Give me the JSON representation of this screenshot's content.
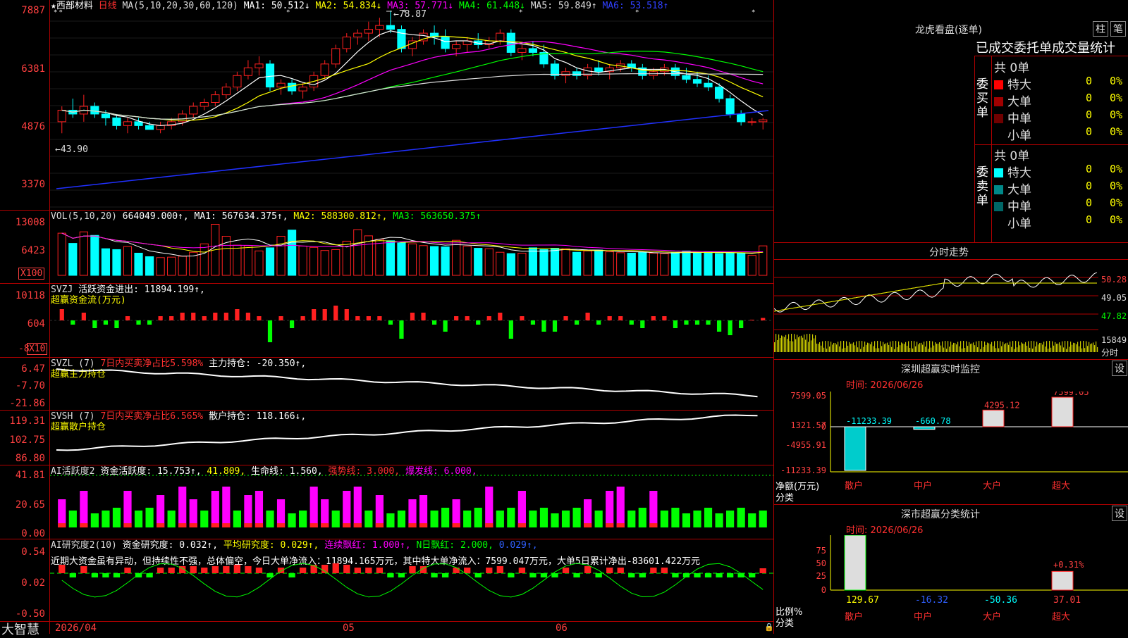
{
  "main_pane": {
    "stock_name": "西部材料",
    "period": "日线",
    "ma_label": "MA(5,10,20,30,60,120)",
    "ma_values": [
      {
        "label": "MA1: 50.512↓",
        "color": "#ffffff"
      },
      {
        "label": "MA2: 54.834↓",
        "color": "#ffff00"
      },
      {
        "label": "MA3: 57.771↓",
        "color": "#ff00ff"
      },
      {
        "label": "MA4: 61.448↓",
        "color": "#00ff00"
      },
      {
        "label": "MA5: 59.849↑",
        "color": "#dddddd"
      },
      {
        "label": "MA6: 53.518↑",
        "color": "#3040ff"
      }
    ],
    "y_ticks": [
      "7887",
      "6381",
      "4876",
      "3370"
    ],
    "high_label": "78.87",
    "low_label": "43.90"
  },
  "vol_pane": {
    "label": "VOL(5,10,20)",
    "value": "664049.000↑,",
    "ma1": "MA1: 567634.375↑,",
    "ma2": "MA2: 588300.812↑,",
    "ma3": "MA3: 563650.375↑",
    "y_ticks": [
      "13008",
      "6423"
    ],
    "unit": "X100"
  },
  "svzj_pane": {
    "label": "SVZJ",
    "title": "活跃资金进出: 11894.199↑,",
    "subtitle": "超赢资金流(万元)",
    "y_ticks": [
      "10118",
      "604",
      "-8"
    ],
    "unit": "X10"
  },
  "svzl_pane": {
    "label": "SVZL (7)",
    "ratio": "7日内买卖净占比5.598%",
    "hold": "主力持仓: -20.350↑,",
    "subtitle": "超赢主力持仓",
    "y_ticks": [
      "6.47",
      "-7.70",
      "-21.86"
    ]
  },
  "svsh_pane": {
    "label": "SVSH (7)",
    "ratio": "7日内买卖净占比6.565%",
    "hold": "散户持仓: 118.166↓,",
    "subtitle": "超赢散户持仓",
    "y_ticks": [
      "119.31",
      "102.75",
      "86.80"
    ]
  },
  "ai_active_pane": {
    "label": "AI活跃度2",
    "v1": "资金活跃度: 15.753↑,",
    "v2": "41.809,",
    "v3": "生命线: 1.560,",
    "v4": "强势线: 3.000,",
    "v5": "爆发线: 6.000,",
    "y_ticks": [
      "41.81",
      "20.65",
      "0.00"
    ]
  },
  "ai_research_pane": {
    "label": "AI研究度2(10)",
    "v1": "资金研究度: 0.032↑,",
    "v2": "平均研究度: 0.029↑,",
    "v3": "连续飘红: 1.000↑,",
    "v4": "N日飘红: 2.000,",
    "v5": "0.029↑,",
    "comment": "近期大资金虽有异动，但持续性不强，总体偏空，今日大单净流入：11894.165万元，其中特大单净流入：7599.047万元，大单5日累计净出-83601.422万元",
    "y_ticks": [
      "0.54",
      "0.02",
      "-0.50"
    ]
  },
  "bottom_bar": {
    "logo": "大智慧",
    "dates": [
      "2026/04",
      "05",
      "06"
    ]
  },
  "right_panel": {
    "dragon_title": "龙虎看盘(逐单)",
    "btn_zhu": "柱",
    "btn_bi": "笔",
    "tabs": [
      "已成交",
      "委托单",
      "成交量统计"
    ],
    "buy_side": "委买单",
    "sell_side": "委卖单",
    "buy_total": "共 0单",
    "sell_total": "共 0单",
    "buy_rows": [
      {
        "label": "特大",
        "count": "0",
        "pct": "0%",
        "color": "#ff0000"
      },
      {
        "label": "大单",
        "count": "0",
        "pct": "0%",
        "color": "#a00000"
      },
      {
        "label": "中单",
        "count": "0",
        "pct": "0%",
        "color": "#700000"
      },
      {
        "label": "小单",
        "count": "0",
        "pct": "0%",
        "color": "#000000"
      }
    ],
    "sell_rows": [
      {
        "label": "特大",
        "count": "0",
        "pct": "0%",
        "color": "#00ffff"
      },
      {
        "label": "大单",
        "count": "0",
        "pct": "0%",
        "color": "#008888"
      },
      {
        "label": "中单",
        "count": "0",
        "pct": "0%",
        "color": "#006666"
      },
      {
        "label": "小单",
        "count": "0",
        "pct": "0%",
        "color": "#000000"
      }
    ],
    "intraday_title": "分时走势",
    "intraday_ticks": [
      "50.28",
      "49.05",
      "47.82"
    ],
    "intraday_vol": "15849",
    "intraday_vol_unit": "分时",
    "monitor_title": "深圳超赢实时监控",
    "monitor_btn": "设",
    "monitor_time": "时间: 2026/06/26",
    "monitor_ticks": [
      "7599.05",
      "1321.57",
      "0",
      "-4955.91",
      "-11233.39"
    ],
    "monitor_ylabel": "净额(万元)",
    "monitor_xlabel": "分类",
    "monitor_cats": [
      "散户",
      "中户",
      "大户",
      "超大"
    ],
    "monitor_vals": [
      "-11233.39",
      "-660.78",
      "4295.12",
      "7599.05"
    ],
    "class_title": "深市超赢分类统计",
    "class_btn": "设",
    "class_time": "时间: 2026/06/26",
    "class_ticks": [
      "75",
      "50",
      "25",
      "0"
    ],
    "class_ylabel": "比例%",
    "class_xlabel": "分类",
    "class_cats": [
      "散户",
      "中户",
      "大户",
      "超大"
    ],
    "class_vals": [
      "129.67",
      "-16.32",
      "-50.36",
      "37.01"
    ],
    "class_annot": "+0.31%"
  },
  "chart_data": [
    {
      "type": "candlestick",
      "title": "西部材料 日线",
      "ylim": [
        3370,
        7887
      ],
      "ohlc": [
        [
          50,
          54,
          47,
          53
        ],
        [
          53,
          56,
          51,
          52
        ],
        [
          52,
          57,
          50,
          54
        ],
        [
          54,
          55,
          51,
          52
        ],
        [
          52,
          53,
          49,
          51
        ],
        [
          51,
          52,
          48,
          49
        ],
        [
          49,
          51,
          47,
          50
        ],
        [
          50,
          51,
          48,
          49
        ],
        [
          49,
          50,
          48,
          48
        ],
        [
          48,
          50,
          47,
          49
        ],
        [
          49,
          51,
          48,
          50
        ],
        [
          50,
          53,
          49,
          52
        ],
        [
          52,
          55,
          51,
          54
        ],
        [
          54,
          56,
          53,
          55
        ],
        [
          55,
          58,
          54,
          57
        ],
        [
          57,
          60,
          56,
          59
        ],
        [
          59,
          63,
          58,
          62
        ],
        [
          62,
          66,
          61,
          64
        ],
        [
          64,
          67,
          62,
          65
        ],
        [
          65,
          66,
          58,
          59
        ],
        [
          59,
          61,
          57,
          60
        ],
        [
          60,
          61,
          57,
          58
        ],
        [
          58,
          60,
          56,
          59
        ],
        [
          59,
          63,
          58,
          62
        ],
        [
          62,
          66,
          61,
          65
        ],
        [
          65,
          70,
          64,
          69
        ],
        [
          69,
          73,
          68,
          72
        ],
        [
          72,
          74,
          70,
          73
        ],
        [
          73,
          76,
          71,
          74
        ],
        [
          74,
          77,
          72,
          75
        ],
        [
          75,
          78.87,
          73,
          74
        ],
        [
          74,
          75,
          68,
          69
        ],
        [
          69,
          72,
          67,
          71
        ],
        [
          71,
          74,
          70,
          73
        ],
        [
          73,
          75,
          70,
          72
        ],
        [
          72,
          74,
          68,
          69
        ],
        [
          69,
          71,
          67,
          70
        ],
        [
          70,
          72,
          68,
          71
        ],
        [
          71,
          73,
          69,
          70
        ],
        [
          70,
          72,
          69,
          71
        ],
        [
          71,
          74,
          70,
          73
        ],
        [
          73,
          74,
          67,
          68
        ],
        [
          68,
          70,
          66,
          69
        ],
        [
          69,
          71,
          67,
          68
        ],
        [
          68,
          70,
          64,
          65
        ],
        [
          65,
          66,
          61,
          62
        ],
        [
          62,
          64,
          60,
          63
        ],
        [
          63,
          64,
          61,
          62
        ],
        [
          62,
          65,
          61,
          64
        ],
        [
          64,
          66,
          62,
          63
        ],
        [
          63,
          65,
          61,
          64
        ],
        [
          64,
          66,
          63,
          65
        ],
        [
          65,
          66,
          63,
          64
        ],
        [
          64,
          65,
          61,
          62
        ],
        [
          62,
          64,
          61,
          63
        ],
        [
          63,
          65,
          62,
          64
        ],
        [
          64,
          65,
          61,
          62
        ],
        [
          62,
          64,
          60,
          61
        ],
        [
          61,
          63,
          59,
          60
        ],
        [
          60,
          62,
          58,
          59
        ],
        [
          59,
          60,
          55,
          56
        ],
        [
          56,
          57,
          51,
          52
        ],
        [
          52,
          53,
          49,
          50
        ],
        [
          50,
          51,
          49,
          50
        ],
        [
          50,
          51,
          48,
          50.5
        ]
      ]
    },
    {
      "type": "bar",
      "title": "VOL(5,10,20)",
      "ylim": [
        0,
        13008
      ],
      "values": [
        9500,
        7200,
        9800,
        9000,
        6000,
        5800,
        6500,
        5000,
        4200,
        4000,
        4100,
        4300,
        5200,
        7100,
        11500,
        8800,
        6800,
        6700,
        5500,
        6200,
        8800,
        10200,
        6600,
        6300,
        5600,
        5800,
        7700,
        10300,
        8900,
        8100,
        7800,
        7300,
        7100,
        6700,
        6500,
        6400,
        7900,
        6600,
        6100,
        6000,
        5200,
        4900,
        5000,
        6200,
        5800,
        6100,
        6000,
        5200,
        5500,
        5700,
        5300,
        5100,
        5000,
        5200,
        5000,
        4900,
        5200,
        5500,
        5100,
        5200,
        4900,
        5100,
        5000,
        4500,
        6640
      ]
    }
  ]
}
